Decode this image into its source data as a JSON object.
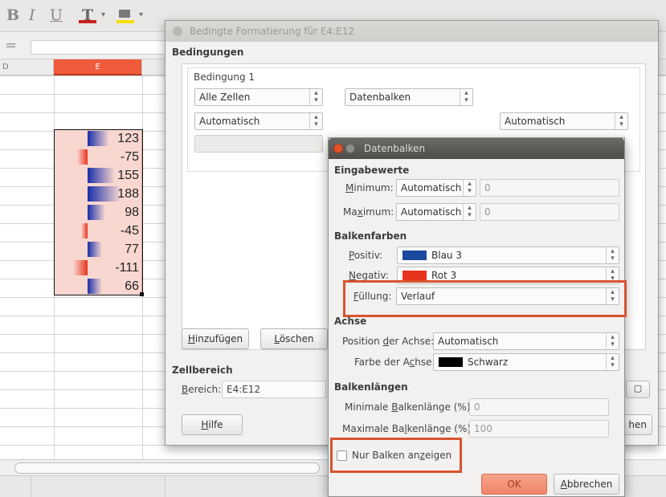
{
  "toolbar": {
    "bold_label": "B",
    "italic_label": "I",
    "underline_label": "U",
    "font_color_icon": "font-color-icon",
    "highlight_icon": "highlight-color-icon"
  },
  "formula_bar": {
    "equals_label": "="
  },
  "column_headers": {
    "d": "D",
    "e": "E"
  },
  "cells_e": [
    {
      "value": "123",
      "sign": "pos",
      "bar": 0.4
    },
    {
      "value": "-75",
      "sign": "neg",
      "bar": 0.14
    },
    {
      "value": "155",
      "sign": "pos",
      "bar": 0.5
    },
    {
      "value": "188",
      "sign": "pos",
      "bar": 0.6
    },
    {
      "value": "98",
      "sign": "pos",
      "bar": 0.32
    },
    {
      "value": "-45",
      "sign": "neg",
      "bar": 0.08
    },
    {
      "value": "77",
      "sign": "pos",
      "bar": 0.25
    },
    {
      "value": "-111",
      "sign": "neg",
      "bar": 0.2
    },
    {
      "value": "66",
      "sign": "pos",
      "bar": 0.22
    }
  ],
  "cf_dialog": {
    "title": "Bedingte Formatierung für E4:E12",
    "conditions_label": "Bedingungen",
    "condition1_label": "Bedingung 1",
    "scope_value": "Alle Zellen",
    "type_value": "Datenbalken",
    "min_value": "Automatisch",
    "max_value": "Automatisch",
    "add_button_text": "inzufügen",
    "add_button_key": "H",
    "delete_button_text": "öschen",
    "delete_button_key": "L",
    "cellrange_label": "Zellbereich",
    "range_label_rest": "ereich:",
    "range_label_key": "B",
    "range_value": "E4:E12",
    "help_button_key": "H",
    "help_button_text": "ilfe",
    "cancel_button_partial": "hen"
  },
  "db_dialog": {
    "title": "Datenbalken",
    "input_values_label": "Eingabewerte",
    "minimum_key": "M",
    "minimum_rest": "inimum:",
    "minimum_value": "Automatisch",
    "minimum_input": "0",
    "maximum_pre": "Ma",
    "maximum_key": "x",
    "maximum_rest": "imum:",
    "maximum_value": "Automatisch",
    "maximum_input": "0",
    "bar_colors_label": "Balkenfarben",
    "positive_key": "P",
    "positive_rest": "ositiv:",
    "positive_value": "Blau 3",
    "positive_color": "#1a4aa0",
    "negative_key": "N",
    "negative_rest": "egativ:",
    "negative_value": "Rot 3",
    "negative_color": "#e8341c",
    "fill_key": "F",
    "fill_rest": "üllung:",
    "fill_value": "Verlauf",
    "axis_label": "Achse",
    "axis_position_pre": "Position ",
    "axis_position_key": "d",
    "axis_position_rest": "er Achse:",
    "axis_position_value": "Automatisch",
    "axis_color_pre": "Farbe der A",
    "axis_color_key": "c",
    "axis_color_rest": "hse:",
    "axis_color_value": "Schwarz",
    "axis_color_swatch": "#000000",
    "bar_lengths_label": "Balkenlängen",
    "min_length_pre": "Minimale ",
    "min_length_key": "B",
    "min_length_rest": "alkenlänge (%):",
    "min_length_value": "0",
    "max_length_pre": "Maximale Ba",
    "max_length_key": "l",
    "max_length_rest": "kenlänge (%):",
    "max_length_value": "100",
    "bars_only_pre": "Nur Balken an",
    "bars_only_key": "z",
    "bars_only_rest": "eigen",
    "ok_button": "OK",
    "cancel_key": "A",
    "cancel_rest": "bbrechen"
  },
  "colors": {
    "accent": "#f05b3b",
    "highlight": "#d9532e",
    "bar_blue": "#1a2fa8",
    "bar_red": "#e8341c",
    "cell_bg": "#f9d7d1"
  }
}
